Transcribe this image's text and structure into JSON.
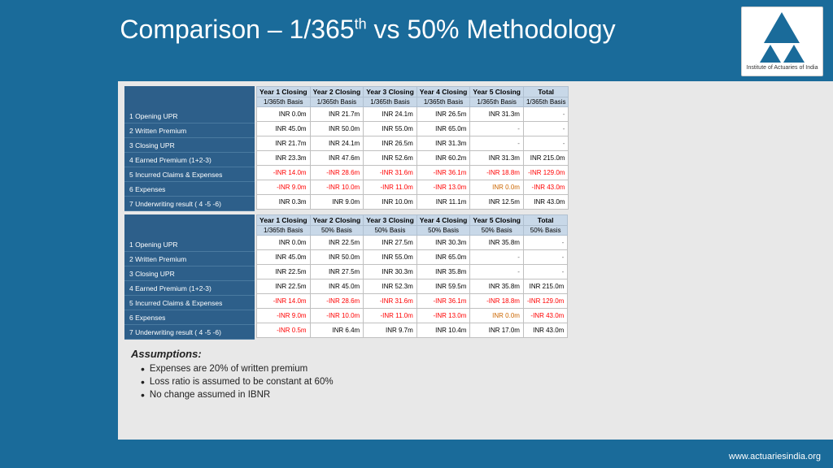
{
  "title": {
    "main": "Comparison – 1/365",
    "sup": "th",
    "rest": " vs 50% Methodology"
  },
  "logo": {
    "org_name": "Institute of Actuaries of India"
  },
  "table1": {
    "row_labels": [
      "1  Opening UPR",
      "2  Written Premium",
      "3  Closing UPR",
      "4  Earned Premium (1+2-3)",
      "5  Incurred Claims & Expenses",
      "6  Expenses",
      "7  Underwriting result ( 4 -5 -6)"
    ],
    "columns": [
      {
        "top": "Year 1 Closing",
        "sub": "1/365th Basis"
      },
      {
        "top": "Year 2 Closing",
        "sub": "1/365th Basis"
      },
      {
        "top": "Year 3 Closing",
        "sub": "1/365th Basis"
      },
      {
        "top": "Year 4 Closing",
        "sub": "1/365th Basis"
      },
      {
        "top": "Year 5 Closing",
        "sub": "1/365th Basis"
      },
      {
        "top": "Total",
        "sub": "1/365th Basis"
      }
    ],
    "rows": [
      [
        "INR 0.0m",
        "INR 21.7m",
        "INR 24.1m",
        "INR 26.5m",
        "INR 31.3m",
        "-"
      ],
      [
        "INR 45.0m",
        "INR 50.0m",
        "INR 55.0m",
        "INR 65.0m",
        "-",
        "-"
      ],
      [
        "INR 21.7m",
        "INR 24.1m",
        "INR 26.5m",
        "INR 31.3m",
        "-",
        "-"
      ],
      [
        "INR 23.3m",
        "INR 47.6m",
        "INR 52.6m",
        "INR 60.2m",
        "INR 31.3m",
        "INR 215.0m"
      ],
      [
        "-INR 14.0m",
        "-INR 28.6m",
        "-INR 31.6m",
        "-INR 36.1m",
        "-INR 18.8m",
        "-INR 129.0m"
      ],
      [
        "-INR 9.0m",
        "-INR 10.0m",
        "-INR 11.0m",
        "-INR 13.0m",
        "INR 0.0m",
        "-INR 43.0m"
      ],
      [
        "INR 0.3m",
        "INR 9.0m",
        "INR 10.0m",
        "INR 11.1m",
        "INR 12.5m",
        "INR 43.0m"
      ]
    ],
    "neg_cells": {
      "4_0": true,
      "4_1": true,
      "4_2": true,
      "4_3": true,
      "4_4": true,
      "4_5": true,
      "5_0": true,
      "5_1": true,
      "5_2": true,
      "5_3": true,
      "5_5": true
    },
    "orange_cells": {
      "5_4": true
    }
  },
  "table2": {
    "row_labels": [
      "1  Opening UPR",
      "2  Written Premium",
      "3  Closing UPR",
      "4  Earned Premium (1+2-3)",
      "5  Incurred Claims & Expenses",
      "6  Expenses",
      "7  Underwriting result ( 4 -5 -6)"
    ],
    "columns": [
      {
        "top": "Year 1 Closing",
        "sub": "1/365th Basis"
      },
      {
        "top": "Year 2 Closing",
        "sub": "50% Basis"
      },
      {
        "top": "Year 3 Closing",
        "sub": "50% Basis"
      },
      {
        "top": "Year 4 Closing",
        "sub": "50% Basis"
      },
      {
        "top": "Year 5 Closing",
        "sub": "50% Basis"
      },
      {
        "top": "Total",
        "sub": "50% Basis"
      }
    ],
    "rows": [
      [
        "INR 0.0m",
        "INR 22.5m",
        "INR 27.5m",
        "INR 30.3m",
        "INR 35.8m",
        "-"
      ],
      [
        "INR 45.0m",
        "INR 50.0m",
        "INR 55.0m",
        "INR 65.0m",
        "-",
        "-"
      ],
      [
        "INR 22.5m",
        "INR 27.5m",
        "INR 30.3m",
        "INR 35.8m",
        "-",
        "-"
      ],
      [
        "INR 22.5m",
        "INR 45.0m",
        "INR 52.3m",
        "INR 59.5m",
        "INR 35.8m",
        "INR 215.0m"
      ],
      [
        "-INR 14.0m",
        "-INR 28.6m",
        "-INR 31.6m",
        "-INR 36.1m",
        "-INR 18.8m",
        "-INR 129.0m"
      ],
      [
        "-INR 9.0m",
        "-INR 10.0m",
        "-INR 11.0m",
        "-INR 13.0m",
        "INR 0.0m",
        "-INR 43.0m"
      ],
      [
        "-INR 0.5m",
        "INR 6.4m",
        "INR 9.7m",
        "INR 10.4m",
        "INR 17.0m",
        "INR 43.0m"
      ]
    ],
    "neg_cells": {
      "4_0": true,
      "4_1": true,
      "4_2": true,
      "4_3": true,
      "4_4": true,
      "4_5": true,
      "5_0": true,
      "5_1": true,
      "5_2": true,
      "5_3": true,
      "5_5": true,
      "6_0": true
    },
    "orange_cells": {
      "5_4": true
    }
  },
  "assumptions": {
    "title": "Assumptions:",
    "items": [
      "Expenses are 20% of written premium",
      "Loss ratio is assumed to be constant at 60%",
      "No change assumed in IBNR"
    ]
  },
  "website": "www.actuariesindia.org"
}
